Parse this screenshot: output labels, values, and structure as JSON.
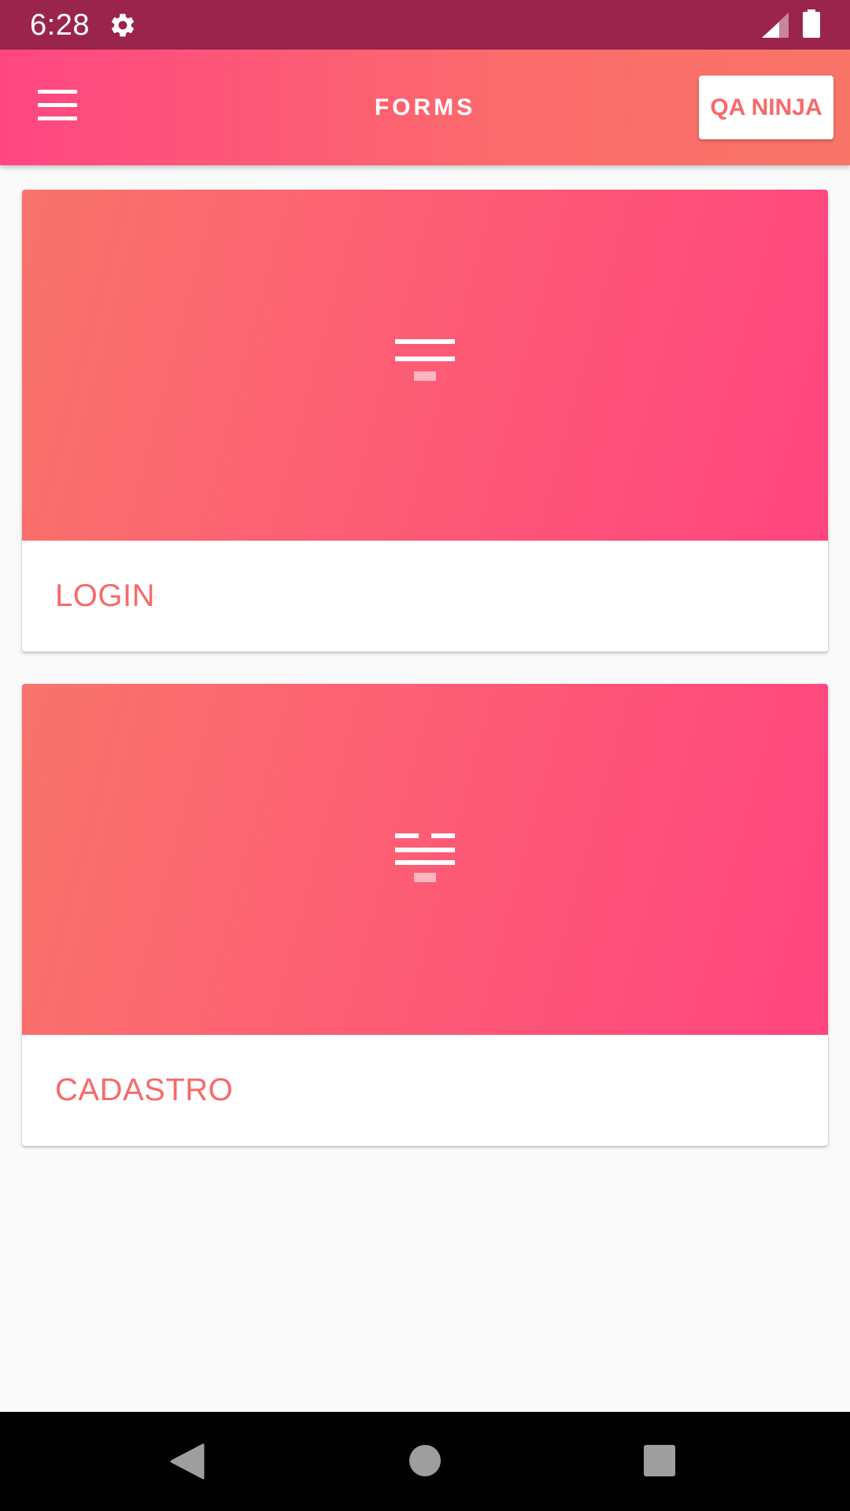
{
  "status_bar": {
    "time": "6:28",
    "icons": [
      "gear-icon",
      "signal-icon",
      "battery-icon"
    ]
  },
  "app_bar": {
    "title": "FORMS",
    "action_label": "QA NINJA",
    "menu_icon": "hamburger-menu-icon"
  },
  "cards": [
    {
      "label": "LOGIN",
      "icon": "form-lines-icon"
    },
    {
      "label": "CADASTRO",
      "icon": "form-lines-icon"
    }
  ],
  "nav_bar": {
    "icons": [
      "back-icon",
      "home-icon",
      "recents-icon"
    ]
  },
  "colors": {
    "status_bar": "#9b244d",
    "accent": "#f76a6a",
    "gradient_pink": "#ff4683",
    "gradient_coral": "#f97568"
  }
}
